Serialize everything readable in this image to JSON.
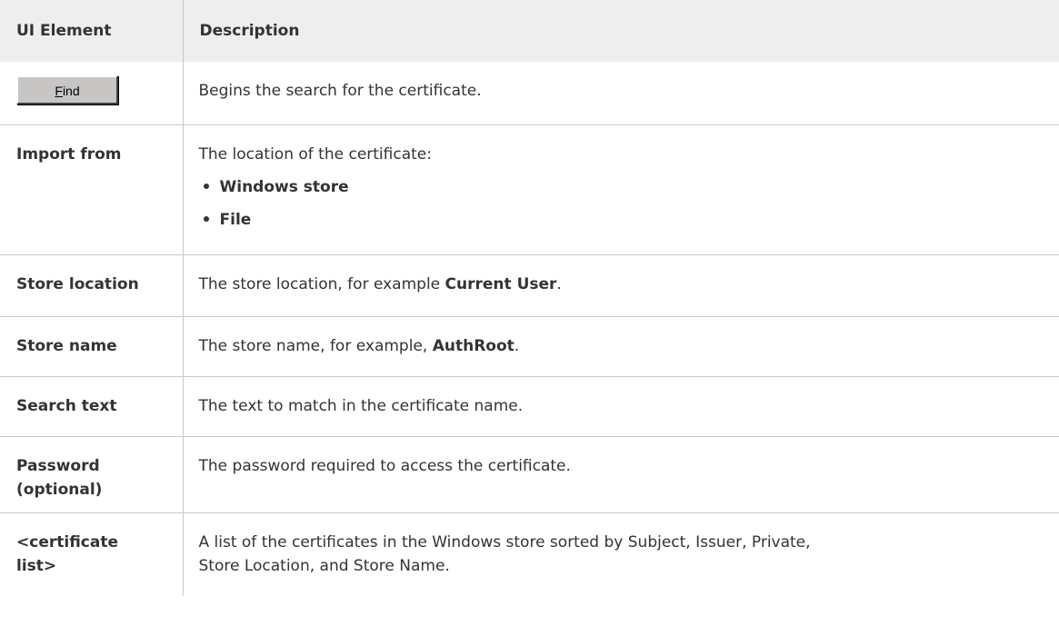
{
  "table": {
    "headers": {
      "element": "UI Element",
      "description": "Description"
    },
    "find_button": {
      "mnemonic": "F",
      "rest": "ind",
      "description": "Begins the search for the certificate."
    },
    "import_from": {
      "label": "Import from",
      "description": "The location of the certificate:",
      "options": [
        "Windows store",
        "File"
      ]
    },
    "store_location": {
      "label": "Store location",
      "description_pre": "The store location, for example ",
      "description_bold": "Current User",
      "description_post": "."
    },
    "store_name": {
      "label": "Store name",
      "description_pre": "The store name, for example, ",
      "description_bold": "AuthRoot",
      "description_post": "."
    },
    "search_text": {
      "label": "Search text",
      "description": "The text to match in the certificate name."
    },
    "password": {
      "label_line1": "Password",
      "label_line2": "(optional)",
      "description": "The password required to access the certificate."
    },
    "certificate_list": {
      "label_line1": "<certificate",
      "label_line2": "list>",
      "description_line1": "A list of the certificates in the Windows store sorted by Subject, Issuer, Private,",
      "description_line2": "Store Location, and Store Name."
    }
  }
}
